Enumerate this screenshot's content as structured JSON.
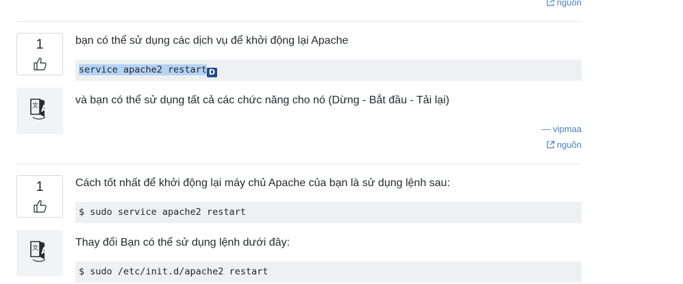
{
  "page": {
    "source_label": "nguồn"
  },
  "answers": [
    {
      "votes": "1",
      "line1": "bạn có thể sử dụng các dịch vụ để khởi động lại Apache",
      "code1": "service apache2 restart",
      "badge": "D",
      "line2": "và bạn có thể sử dụng tất cả các chức năng cho nó (Dừng - Bắt đầu - Tải lại)",
      "author": "— vipmaa",
      "source": "nguồn"
    },
    {
      "votes": "1",
      "line1": "Cách tốt nhất để khởi động lại máy chủ Apache của bạn là sử dụng lệnh sau:",
      "code1": "$ sudo service apache2 restart",
      "line2": "Thay đổi Bạn có thể sử dụng lệnh dưới đây:",
      "code2": "$ sudo /etc/init.d/apache2 restart"
    }
  ],
  "colors": {
    "link": "#4a7fc1",
    "code_bg": "#eff0f1",
    "highlight": "#b4d3f5",
    "badge": "#1f4d8c"
  },
  "icons": {
    "vote": "thumbs-up-icon",
    "translate": "translate-icon",
    "share": "share-icon"
  }
}
